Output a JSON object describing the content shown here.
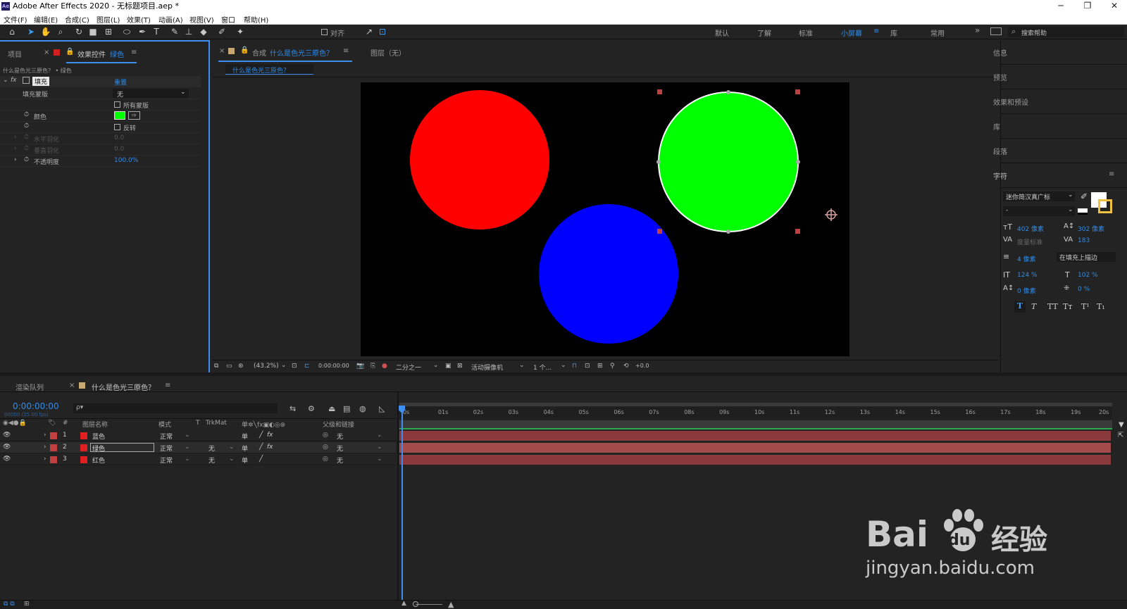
{
  "window": {
    "app_logo": "Ae",
    "title": "Adobe After Effects 2020 - 无标题项目.aep *",
    "min": "─",
    "max": "❐",
    "close": "✕"
  },
  "menu": [
    "文件(F)",
    "编辑(E)",
    "合成(C)",
    "图层(L)",
    "效果(T)",
    "动画(A)",
    "视图(V)",
    "窗口",
    "帮助(H)"
  ],
  "toolbar": {
    "align_label": "对齐",
    "workspaces": [
      "默认",
      "了解",
      "标准",
      "小屏幕",
      "库",
      "常用"
    ],
    "active_workspace": "小屏幕",
    "more": "»",
    "search_placeholder": "搜索帮助"
  },
  "left_panel": {
    "tab_project": "项目",
    "tab_effect_controls": "效果控件",
    "tab_effect_layer": "绿色",
    "breadcrumb": "什么是色光三原色？ • 绿色",
    "effect_name": "填充",
    "effect_reset": "重置",
    "props": [
      {
        "label": "填充蒙版",
        "value": "无"
      },
      {
        "label": "",
        "value": "所有蒙版"
      },
      {
        "label": "颜色",
        "value": ""
      },
      {
        "label": "",
        "value": "反转"
      },
      {
        "label": "水平羽化",
        "value": "0.0"
      },
      {
        "label": "垂直羽化",
        "value": "0.0"
      },
      {
        "label": "不透明度",
        "value": "100.0%"
      }
    ],
    "fill_color": "#00ff00"
  },
  "comp_panel": {
    "tab_prefix": "合成",
    "tab_name": "什么是色光三原色？",
    "tab_layer": "图层（无）",
    "subtab": "什么是色光三原色？",
    "zoom": "(43.2%)",
    "timecode": "0:00:00:00",
    "resolution": "二分之一",
    "camera": "活动摄像机",
    "views": "1 个...",
    "exposure": "+0.0"
  },
  "circles": [
    {
      "name": "red",
      "color": "#ff0000"
    },
    {
      "name": "green",
      "color": "#00ff00"
    },
    {
      "name": "blue",
      "color": "#0000ff"
    }
  ],
  "right_panel": {
    "items": [
      "信息",
      "预览",
      "效果和预设",
      "库",
      "段落",
      "字符"
    ],
    "font": "迷你简汉真广标",
    "font_style": "-",
    "font_size": "402 像素",
    "leading": "302 像素",
    "kerning": "度量标准",
    "tracking": "183",
    "stroke": "4 像素",
    "stroke_mode": "在填充上描边",
    "vscale": "124 %",
    "hscale": "102 %",
    "baseline": "0 像素",
    "tsume": "0 %",
    "text_styles": [
      "T",
      "T",
      "TT",
      "Tт",
      "T¹",
      "T₁"
    ]
  },
  "timeline": {
    "tab_render": "渲染队列",
    "tab_comp": "什么是色光三原色？",
    "timecode": "0:00:00:00",
    "fps": "00000 (25.00 fps)",
    "search_placeholder": "ρ▾",
    "col_num": "#",
    "col_layer": "图层名称",
    "col_mode": "模式",
    "col_t": "T",
    "col_trkmat": "TrkMat",
    "col_parent": "父级和链接",
    "layers": [
      {
        "num": "1",
        "name": "蓝色",
        "mode": "正常",
        "trkmat": "",
        "parent": "无"
      },
      {
        "num": "2",
        "name": "绿色",
        "mode": "正常",
        "trkmat": "无",
        "parent": "无"
      },
      {
        "num": "3",
        "name": "红色",
        "mode": "正常",
        "trkmat": "无",
        "parent": "无"
      }
    ],
    "ticks": [
      "0s",
      "01s",
      "02s",
      "03s",
      "04s",
      "05s",
      "06s",
      "07s",
      "08s",
      "09s",
      "10s",
      "11s",
      "12s",
      "13s",
      "14s",
      "15s",
      "16s",
      "17s",
      "18s",
      "19s",
      "20s"
    ]
  },
  "watermark": {
    "brand": "Bai",
    "brand2": "du",
    "cn": "经验",
    "url": "jingyan.baidu.com"
  }
}
